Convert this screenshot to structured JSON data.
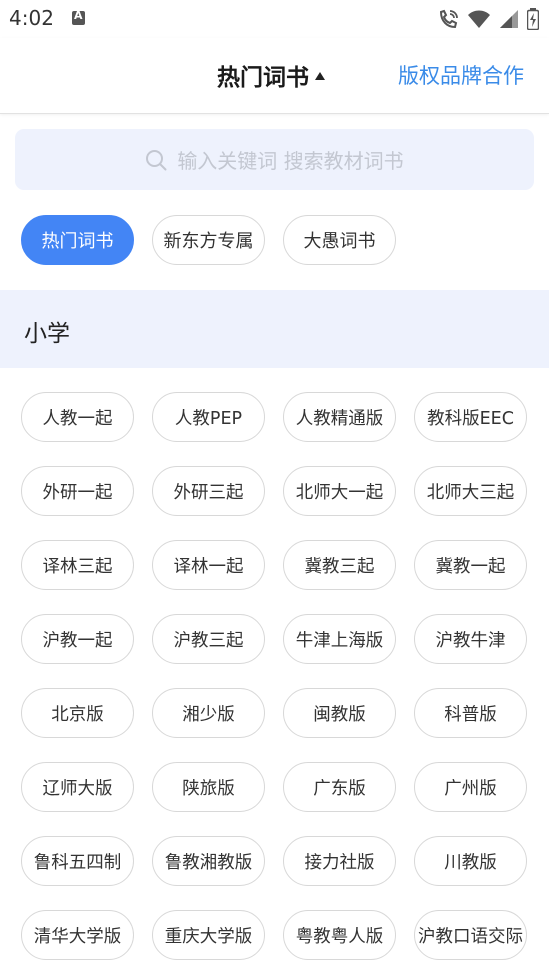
{
  "status_bar": {
    "time": "4:02",
    "icons": [
      "notification-a-icon",
      "call-wifi-icon",
      "wifi-icon",
      "signal-icon",
      "battery-icon"
    ]
  },
  "header": {
    "title": "热门词书",
    "right_link": "版权品牌合作"
  },
  "search": {
    "placeholder": "输入关键词 搜索教材词书"
  },
  "tabs": [
    {
      "label": "热门词书",
      "active": true
    },
    {
      "label": "新东方专属",
      "active": false
    },
    {
      "label": "大愚词书",
      "active": false
    }
  ],
  "section": {
    "title": "小学"
  },
  "books": [
    "人教一起",
    "人教PEP",
    "人教精通版",
    "教科版EEC",
    "外研一起",
    "外研三起",
    "北师大一起",
    "北师大三起",
    "译林三起",
    "译林一起",
    "冀教三起",
    "冀教一起",
    "沪教一起",
    "沪教三起",
    "牛津上海版",
    "沪教牛津",
    "北京版",
    "湘少版",
    "闽教版",
    "科普版",
    "辽师大版",
    "陕旅版",
    "广东版",
    "广州版",
    "鲁科五四制",
    "鲁教湘教版",
    "接力社版",
    "川教版",
    "清华大学版",
    "重庆大学版",
    "粤教粤人版",
    "沪教口语交际"
  ],
  "colors": {
    "accent": "#4385f5",
    "link": "#3a8be8",
    "section_bg": "#eef2fd"
  }
}
